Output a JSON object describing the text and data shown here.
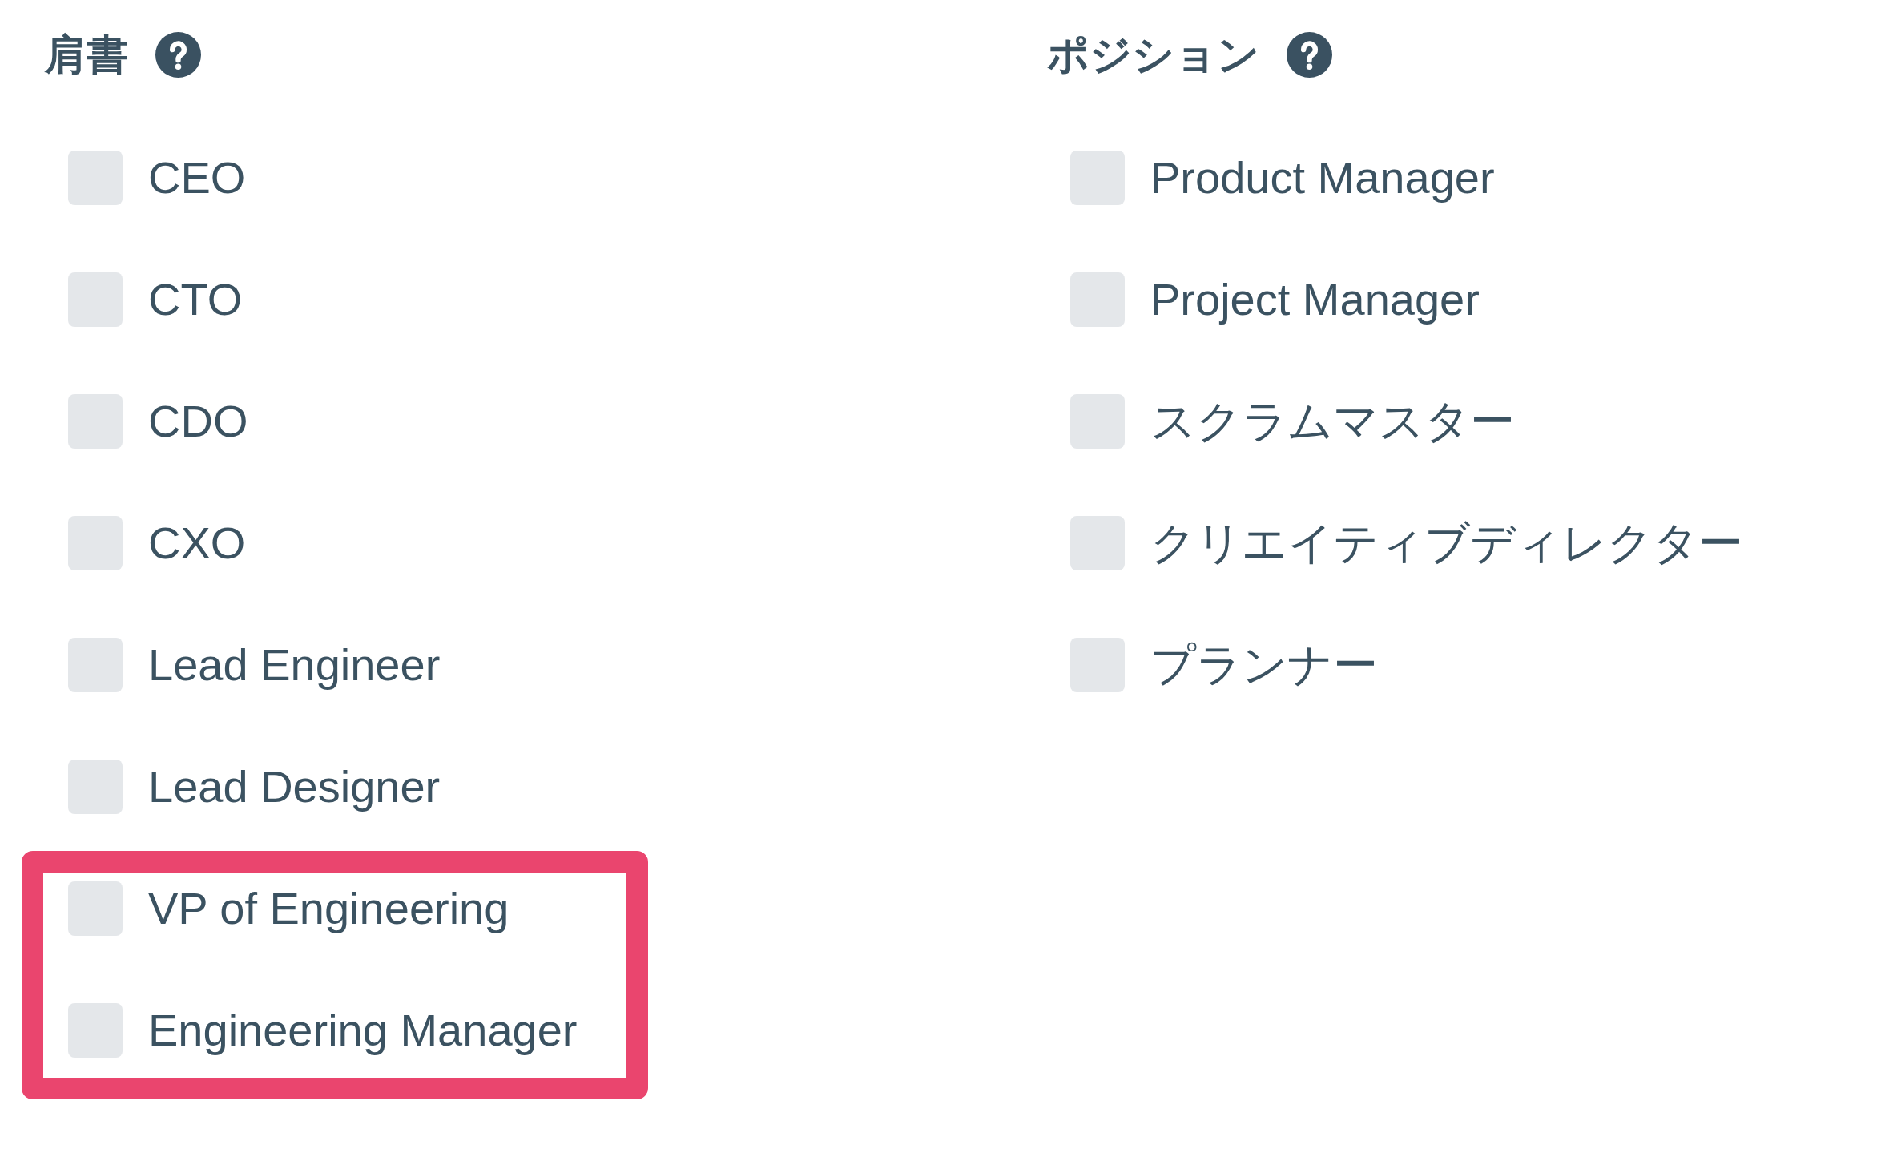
{
  "columns": [
    {
      "heading": "肩書",
      "items": [
        {
          "label": "CEO",
          "checked": false,
          "highlighted": false
        },
        {
          "label": "CTO",
          "checked": false,
          "highlighted": false
        },
        {
          "label": "CDO",
          "checked": false,
          "highlighted": false
        },
        {
          "label": "CXO",
          "checked": false,
          "highlighted": false
        },
        {
          "label": "Lead Engineer",
          "checked": false,
          "highlighted": false
        },
        {
          "label": "Lead Designer",
          "checked": false,
          "highlighted": false
        },
        {
          "label": "VP of Engineering",
          "checked": false,
          "highlighted": true
        },
        {
          "label": "Engineering Manager",
          "checked": false,
          "highlighted": true
        }
      ]
    },
    {
      "heading": "ポジション",
      "items": [
        {
          "label": "Product Manager",
          "checked": false,
          "highlighted": false
        },
        {
          "label": "Project Manager",
          "checked": false,
          "highlighted": false
        },
        {
          "label": "スクラムマスター",
          "checked": false,
          "highlighted": false
        },
        {
          "label": "クリエイティブディレクター",
          "checked": false,
          "highlighted": false
        },
        {
          "label": "プランナー",
          "checked": false,
          "highlighted": false
        }
      ]
    }
  ]
}
